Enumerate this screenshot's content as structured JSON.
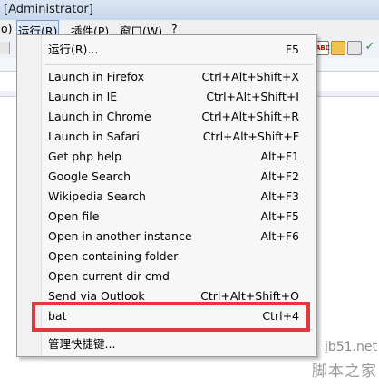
{
  "window": {
    "title": "[Administrator]"
  },
  "menubar": {
    "items": [
      {
        "label": "o)"
      },
      {
        "label": "运行(R)"
      },
      {
        "label": "插件(P)"
      },
      {
        "label": "窗口(W)"
      },
      {
        "label": "?"
      }
    ]
  },
  "dropdown": {
    "items": [
      {
        "label": "运行(R)...",
        "shortcut": "F5"
      },
      {
        "label": "Launch in Firefox",
        "shortcut": "Ctrl+Alt+Shift+X"
      },
      {
        "label": "Launch in IE",
        "shortcut": "Ctrl+Alt+Shift+I"
      },
      {
        "label": "Launch in Chrome",
        "shortcut": "Ctrl+Alt+Shift+R"
      },
      {
        "label": "Launch in Safari",
        "shortcut": "Ctrl+Alt+Shift+F"
      },
      {
        "label": "Get php help",
        "shortcut": "Alt+F1"
      },
      {
        "label": "Google Search",
        "shortcut": "Alt+F2"
      },
      {
        "label": "Wikipedia Search",
        "shortcut": "Alt+F3"
      },
      {
        "label": "Open file",
        "shortcut": "Alt+F5"
      },
      {
        "label": "Open in another instance",
        "shortcut": "Alt+F6"
      },
      {
        "label": "Open containing folder",
        "shortcut": ""
      },
      {
        "label": "Open current dir cmd",
        "shortcut": ""
      },
      {
        "label": "Send via Outlook",
        "shortcut": "Ctrl+Alt+Shift+O"
      },
      {
        "label": "bat",
        "shortcut": "Ctrl+4"
      },
      {
        "label": "管理快捷键...",
        "shortcut": ""
      }
    ]
  },
  "toolbar": {
    "icons": [
      "abc-spellcheck-icon",
      "save-icon",
      "fax-icon",
      "check-icon"
    ]
  },
  "watermark": {
    "line1": "jb51.net",
    "line2": "脚本之家"
  },
  "colors": {
    "highlight_border": "#e0383e",
    "menu_bg": "#f7f7f7"
  }
}
